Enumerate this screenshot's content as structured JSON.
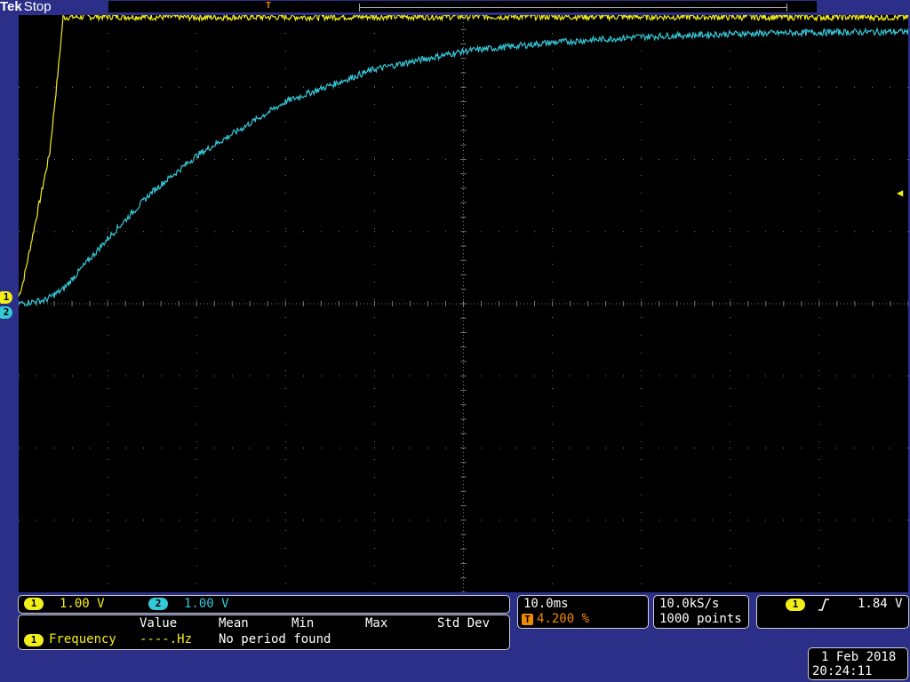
{
  "header": {
    "brand": "Tek",
    "acq_state": "Stop",
    "trigger_glyph": "T"
  },
  "colors": {
    "ch1": "#f2ee1c",
    "ch2": "#35c8d8",
    "trigger": "#f08a00",
    "frame": "#2b2f87",
    "grid": "#7a7a7a"
  },
  "channels": [
    {
      "id": "1",
      "scale": "1.00 V"
    },
    {
      "id": "2",
      "scale": "1.00 V"
    }
  ],
  "measurement": {
    "headers": [
      "Value",
      "Mean",
      "Min",
      "Max",
      "Std Dev"
    ],
    "source": "1",
    "name": "Frequency",
    "value": "----.Hz",
    "message": "No period found"
  },
  "horizontal": {
    "scale": "10.0ms",
    "trigger_position": "4.200 %"
  },
  "acquisition": {
    "sample_rate": "10.0kS/s",
    "record_length": "1000 points"
  },
  "trigger": {
    "source": "1",
    "slope_icon": "rising-edge-icon",
    "level": "1.84 V"
  },
  "datetime": {
    "date": "1 Feb  2018",
    "time": "20:24:11"
  },
  "chart_data": {
    "type": "line",
    "xlabel": "",
    "ylabel": "",
    "x_divisions": 10,
    "y_divisions": 8,
    "grid": true,
    "series": [
      {
        "name": "1",
        "description": "step rising to plateau",
        "x": [
          0,
          0.05,
          0.1,
          0.15,
          0.2,
          0.25,
          0.3,
          0.35,
          0.4,
          0.45,
          0.5,
          1,
          2,
          5,
          10
        ],
        "y": [
          0.1,
          0.3,
          0.6,
          0.9,
          1.2,
          1.5,
          1.8,
          2.1,
          2.7,
          3.3,
          3.97,
          3.98,
          3.97,
          3.98,
          3.97
        ]
      },
      {
        "name": "2",
        "description": "exponential charge curve",
        "x": [
          0,
          0.3,
          0.5,
          1,
          1.5,
          2,
          3,
          4,
          5,
          6,
          7,
          8,
          9,
          10
        ],
        "y": [
          0,
          0.05,
          0.2,
          0.9,
          1.55,
          2.05,
          2.8,
          3.25,
          3.5,
          3.62,
          3.7,
          3.74,
          3.76,
          3.77
        ]
      }
    ]
  }
}
